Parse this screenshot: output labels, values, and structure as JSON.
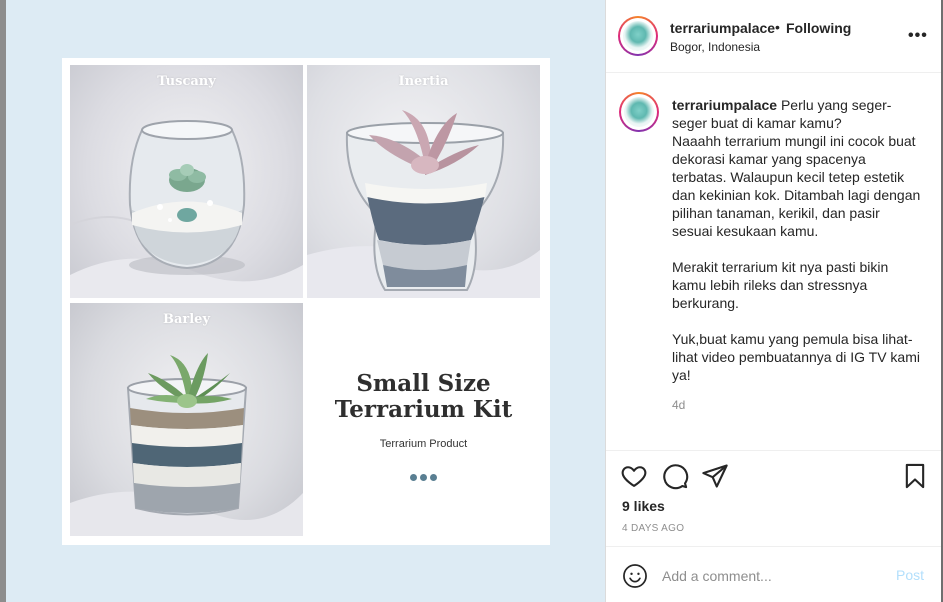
{
  "colors": {
    "media_bg": "#ddebf4",
    "link_disabled": "#b2dffc",
    "muted": "#8e8e8e",
    "text": "#262626",
    "dots_accent": "#5a7f92"
  },
  "post": {
    "username": "terrariumpalace",
    "dot": "•",
    "follow_status": "Following",
    "location": "Bogor, Indonesia",
    "more_icon": "more-horizontal-icon",
    "more_text": "•••"
  },
  "image": {
    "labels": [
      "Tuscany",
      "Inertia",
      "Barley"
    ],
    "promo_title_line1": "Small Size",
    "promo_title_line2": "Terrarium Kit",
    "promo_subtitle": "Terrarium Product"
  },
  "caption": {
    "username": "terrariumpalace",
    "paragraph1": "Perlu yang seger-seger buat di kamar kamu?",
    "paragraph2": "Naaahh terrarium mungil ini cocok buat dekorasi kamar yang spacenya terbatas. Walaupun kecil tetep estetik dan kekinian kok. Ditambah lagi dengan pilihan tanaman, kerikil, dan pasir sesuai kesukaan kamu.",
    "paragraph3": "Merakit terrarium kit nya pasti bikin kamu lebih rileks dan stressnya berkurang.",
    "paragraph4": "Yuk,buat kamu yang pemula bisa lihat-lihat video pembuatannya di IG TV kami ya!",
    "time": "4d"
  },
  "actions": {
    "icons": [
      "heart-icon",
      "comment-icon",
      "share-icon",
      "bookmark-icon"
    ],
    "likes": "9 likes",
    "posted": "4 DAYS AGO"
  },
  "comment": {
    "placeholder": "Add a comment...",
    "post_label": "Post",
    "emoji_icon": "emoji-icon"
  }
}
